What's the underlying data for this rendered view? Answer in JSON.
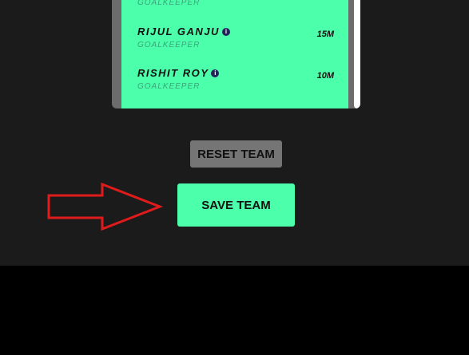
{
  "players": [
    {
      "name": "",
      "role": "GOALKEEPER",
      "price": ""
    },
    {
      "name": "RIJUL GANJU",
      "role": "GOALKEEPER",
      "price": "15M"
    },
    {
      "name": "RISHIT ROY",
      "role": "GOALKEEPER",
      "price": "10M"
    }
  ],
  "info_glyph": "i",
  "buttons": {
    "reset_label": "RESET TEAM",
    "save_label": "SAVE TEAM"
  },
  "colors": {
    "accent": "#4cffaa",
    "background": "#1b1b1b",
    "reset_button": "#757575",
    "annotation_arrow": "#e01b1b"
  }
}
